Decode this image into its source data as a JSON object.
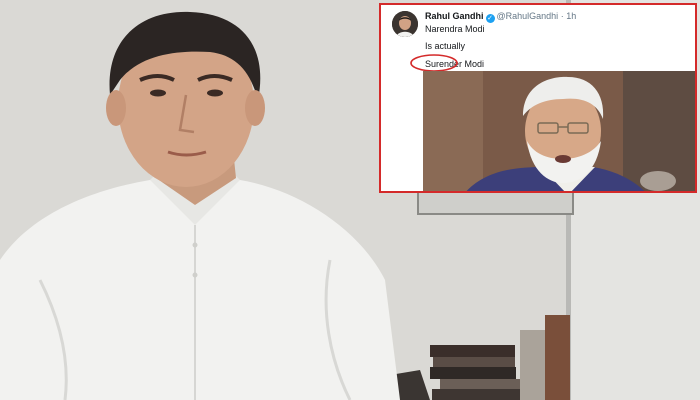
{
  "tweet": {
    "author_name": "Rahul Gandhi",
    "handle": "@RahulGandhi",
    "separator": "·",
    "time": "1h",
    "line1": "Narendra Modi",
    "line2": "Is actually",
    "line3": "Surender Modi"
  },
  "colors": {
    "highlight_border": "#d42a2a",
    "verified": "#1da1f2"
  },
  "icons": {
    "verified": "verified-badge-icon"
  }
}
